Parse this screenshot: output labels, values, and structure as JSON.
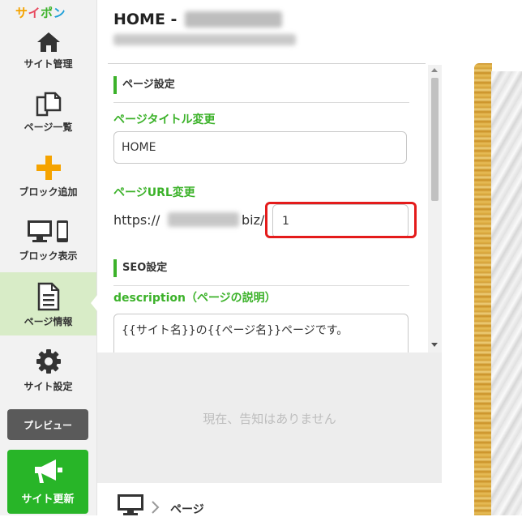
{
  "sidebar": {
    "logo": "サイポン",
    "items": [
      {
        "label": "サイト管理",
        "icon": "home-icon"
      },
      {
        "label": "ページ一覧",
        "icon": "pages-icon"
      },
      {
        "label": "ブロック追加",
        "icon": "plus-icon"
      },
      {
        "label": "ブロック表示",
        "icon": "devices-icon"
      },
      {
        "label": "ページ情報",
        "icon": "document-icon",
        "active": true
      },
      {
        "label": "サイト設定",
        "icon": "gear-icon"
      }
    ],
    "preview_label": "プレビュー",
    "update_label": "サイト更新"
  },
  "panel": {
    "title": "HOME -",
    "page_settings": {
      "heading": "ページ設定",
      "title_label": "ページタイトル変更",
      "title_value": "HOME",
      "url_label": "ページURL変更",
      "url_prefix": "https://",
      "url_suffix": "biz/",
      "url_slug_value": "1"
    },
    "seo": {
      "heading": "SEO設定",
      "description_label": "description（ページの説明）",
      "description_value": "{{サイト名}}の{{ページ名}}ページです。"
    },
    "notice": "現在、告知はありません",
    "breadcrumb": "ページ"
  },
  "colors": {
    "accent_green": "#3cb22a",
    "highlight_red": "#e41b1b",
    "update_button": "#28b528",
    "plus_icon": "#f5a300"
  }
}
